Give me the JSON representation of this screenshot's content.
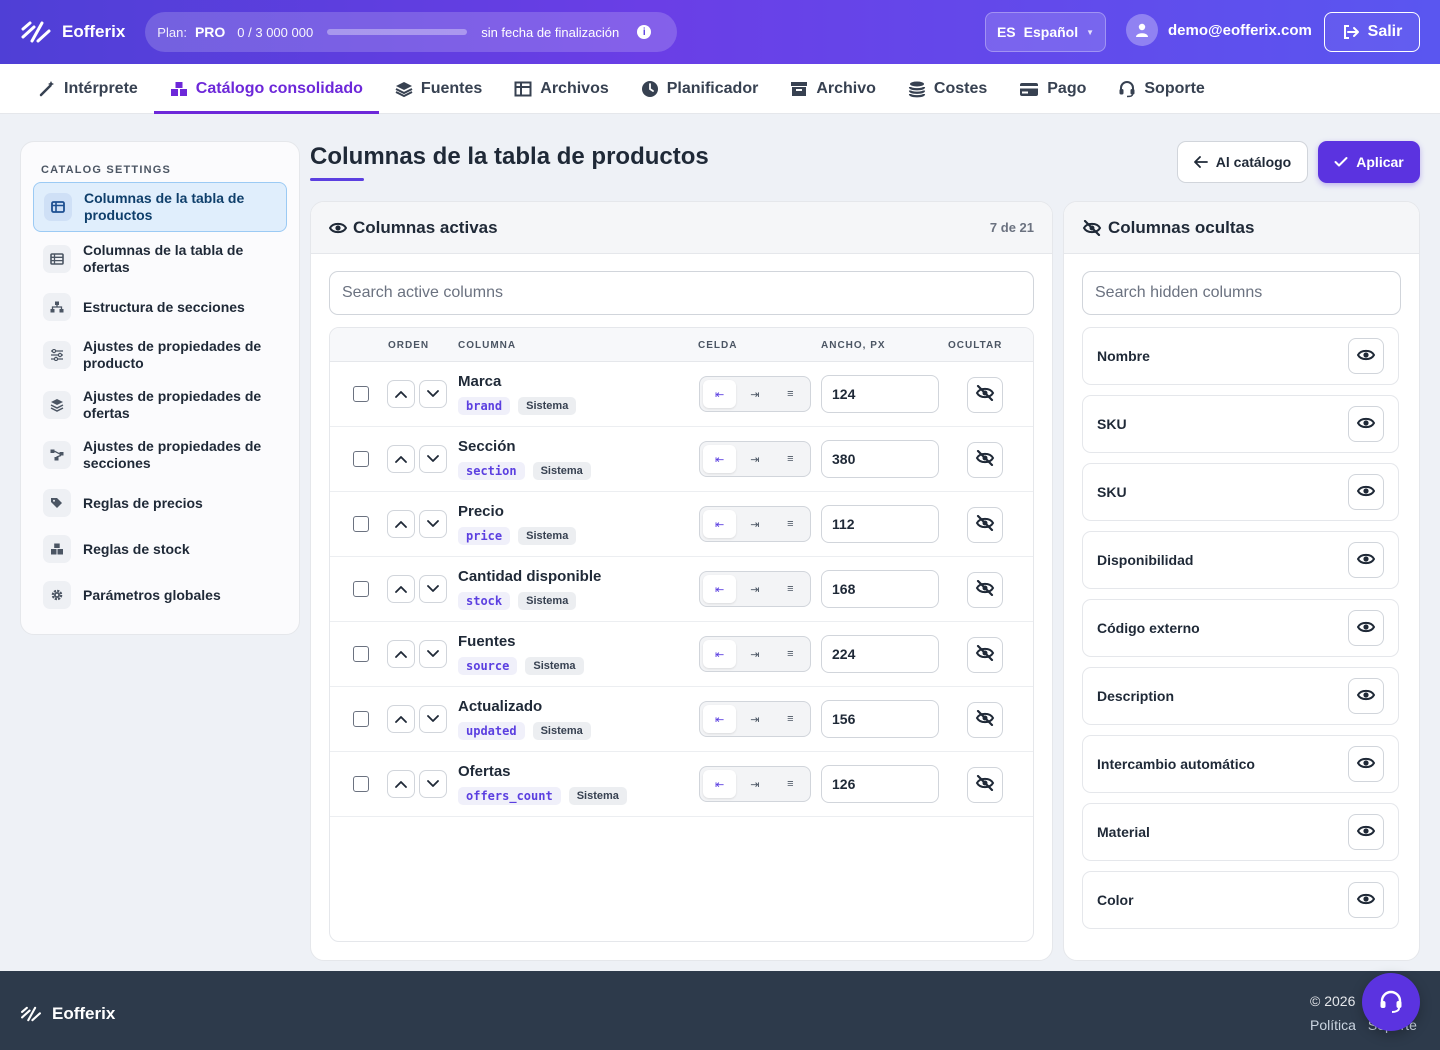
{
  "app": {
    "name": "Eofferix"
  },
  "plan": {
    "label": "Plan:",
    "name": "PRO",
    "usage": "0 / 3 000 000",
    "used_fraction": 0,
    "end": "sin fecha de finalización",
    "info": "i"
  },
  "language": {
    "code": "ES",
    "name": "Español"
  },
  "user": {
    "email": "demo@eofferix.com"
  },
  "logout": {
    "label": "Salir"
  },
  "tabs": [
    {
      "label": "Intérprete",
      "icon": "magic-wand-icon"
    },
    {
      "label": "Catálogo consolidado",
      "icon": "boxes-icon",
      "active": true
    },
    {
      "label": "Fuentes",
      "icon": "layers-icon"
    },
    {
      "label": "Archivos",
      "icon": "table-icon"
    },
    {
      "label": "Planificador",
      "icon": "clock-icon"
    },
    {
      "label": "Archivo",
      "icon": "archive-icon"
    },
    {
      "label": "Costes",
      "icon": "coins-icon"
    },
    {
      "label": "Pago",
      "icon": "credit-card-icon"
    },
    {
      "label": "Soporte",
      "icon": "headset-icon"
    }
  ],
  "sidebar": {
    "title": "CATALOG SETTINGS",
    "items": [
      {
        "label": "Columnas de la tabla de productos",
        "icon": "columns-icon",
        "active": true
      },
      {
        "label": "Columnas de la tabla de ofertas",
        "icon": "list-icon"
      },
      {
        "label": "Estructura de secciones",
        "icon": "sitemap-icon"
      },
      {
        "label": "Ajustes de propiedades de producto",
        "icon": "sliders-icon"
      },
      {
        "label": "Ajustes de propiedades de ofertas",
        "icon": "layers-icon"
      },
      {
        "label": "Ajustes de propiedades de secciones",
        "icon": "nodes-icon"
      },
      {
        "label": "Reglas de precios",
        "icon": "tags-icon"
      },
      {
        "label": "Reglas de stock",
        "icon": "boxes-icon"
      },
      {
        "label": "Parámetros globales",
        "icon": "gear-icon"
      }
    ]
  },
  "page": {
    "title": "Columnas de la tabla de productos",
    "back_label": "Al catálogo",
    "apply_label": "Aplicar"
  },
  "active_panel": {
    "title": "Columnas activas",
    "count": "7 de 21",
    "search_placeholder": "Search active columns",
    "headers": {
      "order": "ORDEN",
      "column": "COLUMNA",
      "cell": "CELDA",
      "width": "ANCHO, PX",
      "hide": "OCULTAR"
    },
    "align_options": [
      "⇤",
      "⇥",
      "≡"
    ],
    "rows": [
      {
        "name": "Marca",
        "key": "brand",
        "badge": "Sistema",
        "width": "124"
      },
      {
        "name": "Sección",
        "key": "section",
        "badge": "Sistema",
        "width": "380"
      },
      {
        "name": "Precio",
        "key": "price",
        "badge": "Sistema",
        "width": "112"
      },
      {
        "name": "Cantidad disponible",
        "key": "stock",
        "badge": "Sistema",
        "width": "168"
      },
      {
        "name": "Fuentes",
        "key": "source",
        "badge": "Sistema",
        "width": "224"
      },
      {
        "name": "Actualizado",
        "key": "updated",
        "badge": "Sistema",
        "width": "156"
      },
      {
        "name": "Ofertas",
        "key": "offers_count",
        "badge": "Sistema",
        "width": "126"
      }
    ]
  },
  "hidden_panel": {
    "title": "Columnas ocultas",
    "search_placeholder": "Search hidden columns",
    "items": [
      "Nombre",
      "SKU",
      "SKU",
      "Disponibilidad",
      "Código externo",
      "Description",
      "Intercambio automático",
      "Material",
      "Color"
    ]
  },
  "footer": {
    "brand": "Eofferix",
    "copyright": "© 2026",
    "links": [
      "Política",
      "Soporte"
    ]
  },
  "colors": {
    "accent": "#5b33e0",
    "header_gradient_start": "#4f3fd6",
    "footer": "#2d3a4b"
  }
}
